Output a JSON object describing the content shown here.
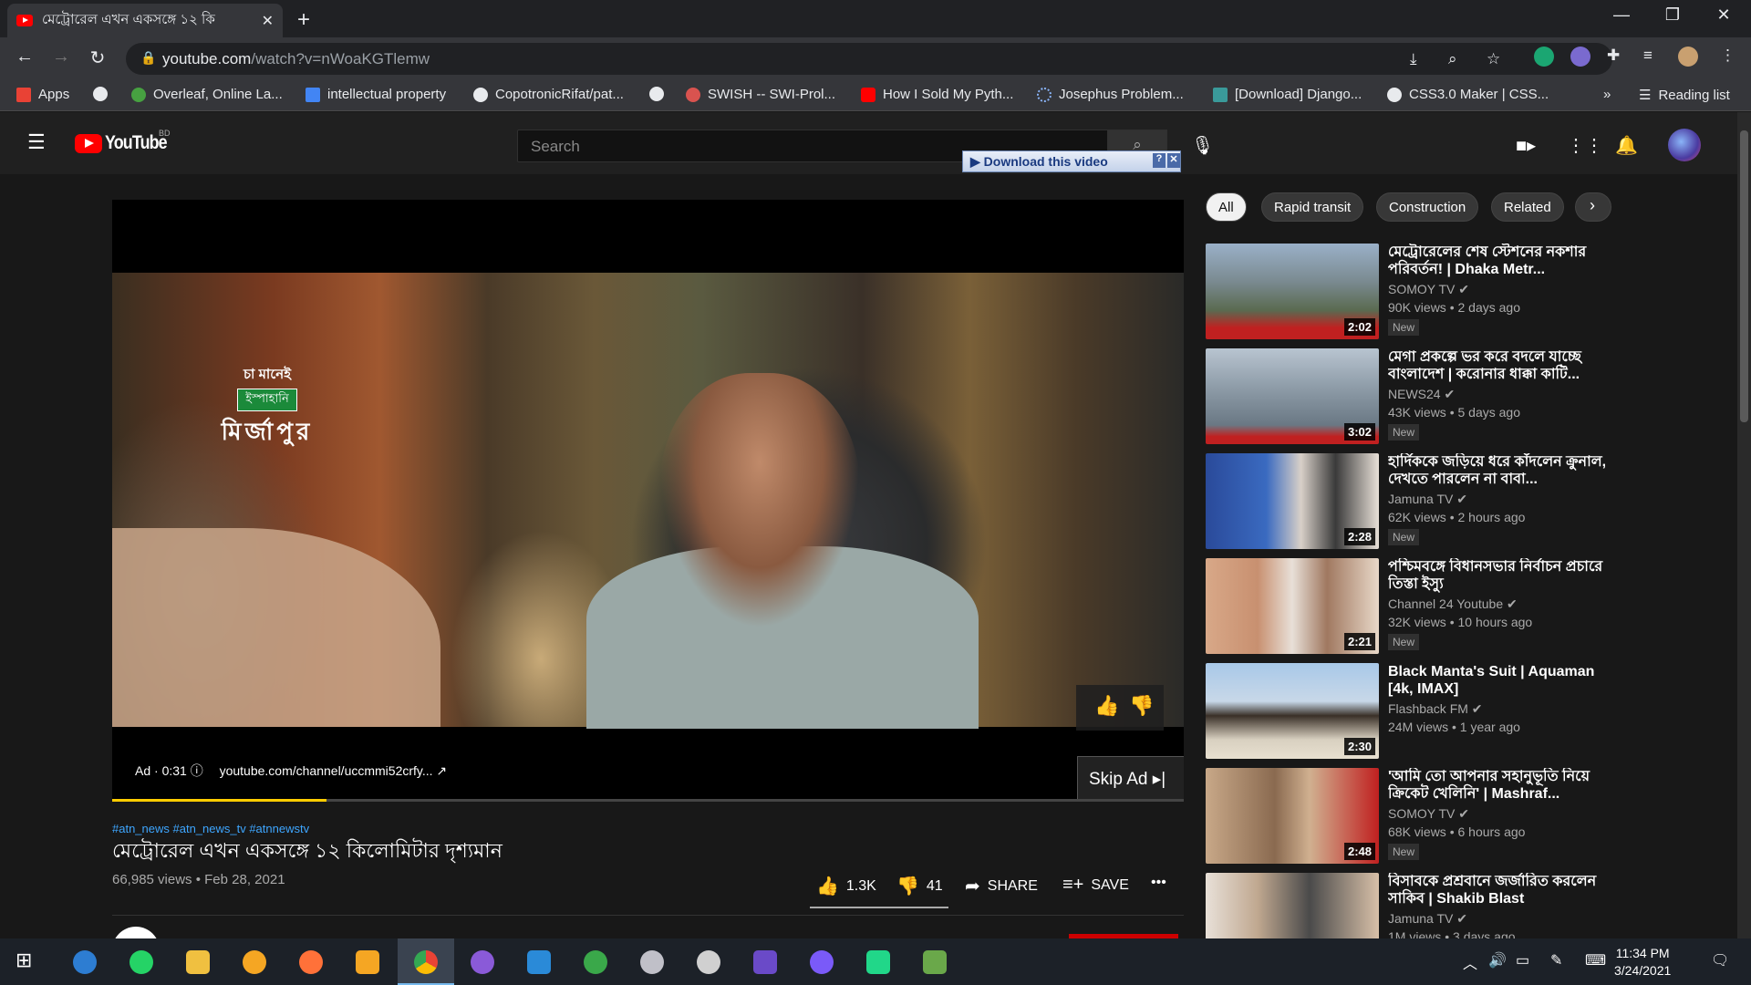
{
  "browser": {
    "tab_title": "মেট্রোরেল এখন একসঙ্গে ১২ কি",
    "new_tab": "+",
    "url_domain": "youtube.com",
    "url_path": "/watch?v=nWoaKGTlemw",
    "window_controls": [
      "—",
      "❐",
      "✕"
    ]
  },
  "bookmarks": [
    {
      "label": "Apps",
      "color": "#e94235"
    },
    {
      "label": "",
      "color": "#e8eaed"
    },
    {
      "label": "Overleaf, Online La...",
      "color": "#47a141"
    },
    {
      "label": "intellectual property",
      "color": "#4285f4"
    },
    {
      "label": "CopotronicRifat/pat...",
      "color": "#e8eaed"
    },
    {
      "label": "",
      "color": "#e8eaed"
    },
    {
      "label": "SWISH -- SWI-Prol...",
      "color": "#d9534f"
    },
    {
      "label": "How I Sold My Pyth...",
      "color": "#ff0000"
    },
    {
      "label": "Josephus Problem...",
      "color": "#8ab4f8"
    },
    {
      "label": "[Download] Django...",
      "color": "#3a9a9a"
    },
    {
      "label": "CSS3.0 Maker | CSS...",
      "color": "#e8eaed"
    }
  ],
  "bookmarks_overflow": "»",
  "reading_list": "Reading list",
  "youtube": {
    "logo_text": "YouTube",
    "country": "BD",
    "search_placeholder": "Search",
    "download_bar": "▶ Download this video",
    "download_help": "?",
    "download_close": "✕"
  },
  "player": {
    "overlay_line1": "চা মানেই",
    "overlay_line2": "ইস্পাহানি",
    "overlay_line3": "মির্জাপুর",
    "skip_ad": "Skip Ad ▸|",
    "ad_label": "Ad · 0:31  ⓘ",
    "ad_url": "youtube.com/channel/uccmmi52crfy... ↗",
    "progress": 0.2
  },
  "video": {
    "hashtags": "#atn_news #atn_news_tv #atnnewstv",
    "title": "মেট্রোরেল এখন একসঙ্গে ১২ কিলোমিটার দৃশ্যমান",
    "views_date": "66,985 views • Feb 28, 2021",
    "likes": "1.3K",
    "dislikes": "41",
    "share": "SHARE",
    "save": "SAVE",
    "more": "•••"
  },
  "chips": [
    "All",
    "Rapid transit",
    "Construction",
    "Related"
  ],
  "recommendations": [
    {
      "title": "মেট্রোরেলের শেষ স্টেশনের নকশার পরিবর্তন! | Dhaka Metr...",
      "channel": "SOMOY TV ✔",
      "meta": "90K views • 2 days ago",
      "badge": "New",
      "duration": "2:02"
    },
    {
      "title": "মেগা প্রকল্পে ভর করে বদলে যাচ্ছে বাংলাদেশ | করোনার ধাক্কা কাটি...",
      "channel": "NEWS24 ✔",
      "meta": "43K views • 5 days ago",
      "badge": "New",
      "duration": "3:02"
    },
    {
      "title": "হার্দিককে জড়িয়ে ধরে কাঁদলেন ক্রুনাল, দেখতে পারলেন না বাবা...",
      "channel": "Jamuna TV ✔",
      "meta": "62K views • 2 hours ago",
      "badge": "New",
      "duration": "2:28"
    },
    {
      "title": "পশ্চিমবঙ্গে বিধানসভার নির্বাচন প্রচারে তিস্তা ইস্যু",
      "channel": "Channel 24 Youtube ✔",
      "meta": "32K views • 10 hours ago",
      "badge": "New",
      "duration": "2:21"
    },
    {
      "title": "Black Manta's Suit | Aquaman [4k, IMAX]",
      "channel": "Flashback FM ✔",
      "meta": "24M views • 1 year ago",
      "badge": "",
      "duration": "2:30"
    },
    {
      "title": "'আমি তো আপনার সহানুভূতি নিয়ে ক্রিকেট খেলিনি' | Mashraf...",
      "channel": "SOMOY TV ✔",
      "meta": "68K views • 6 hours ago",
      "badge": "New",
      "duration": "2:48"
    },
    {
      "title": "বিসাবকে প্রশ্রবানে জর্জারিত করলেন সাকিব | Shakib Blast",
      "channel": "Jamuna TV ✔",
      "meta": "1M views • 3 days ago",
      "badge": "",
      "duration": ""
    }
  ],
  "taskbar": {
    "time": "11:34 PM",
    "date": "3/24/2021"
  }
}
